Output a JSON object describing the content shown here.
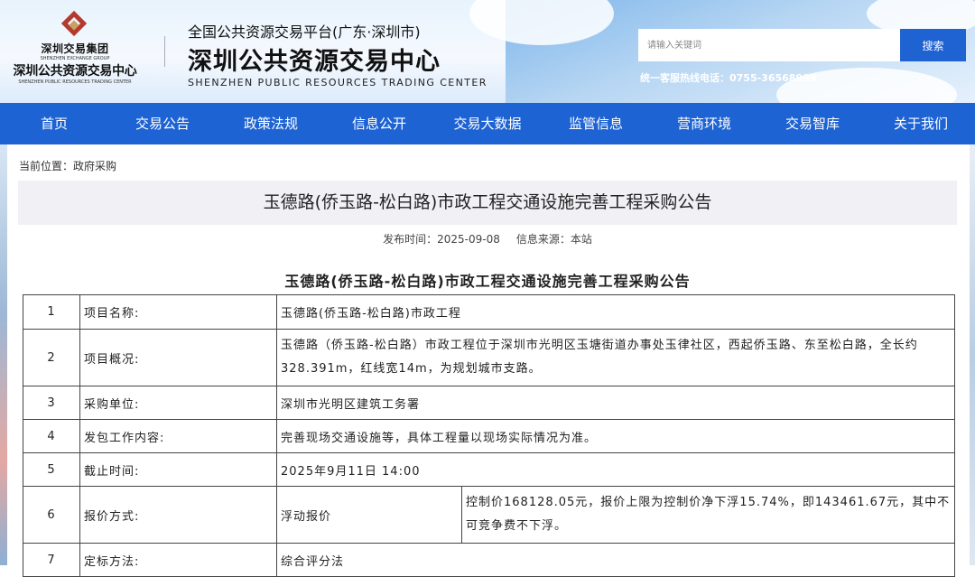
{
  "header": {
    "group_name_cn": "深圳交易集团",
    "group_name_en": "SHENZHEN EXCHANGE GROUP",
    "center_name_cn": "深圳公共资源交易中心",
    "center_name_en": "SHENZHEN PUBLIC RESOURCES TRADING CENTER",
    "platform_title": "全国公共资源交易平台(广东·深圳市)",
    "platform_name": "深圳公共资源交易中心",
    "platform_name_en": "SHENZHEN PUBLIC RESOURCES TRADING CENTER",
    "search_placeholder": "请输入关键词",
    "search_button": "搜索",
    "hotline": "统一客服热线电话：0755-36568999"
  },
  "nav": {
    "items": [
      "首页",
      "交易公告",
      "政策法规",
      "信息公开",
      "交易大数据",
      "监管信息",
      "营商环境",
      "交易智库",
      "关于我们"
    ]
  },
  "breadcrumb": "当前位置：政府采购",
  "article": {
    "title": "玉德路(侨玉路-松白路)市政工程交通设施完善工程采购公告",
    "publish_time": "发布时间：2025-09-08",
    "source": "信息来源：本站",
    "subtitle": "玉德路(侨玉路-松白路)市政工程交通设施完善工程采购公告"
  },
  "table": {
    "rows": [
      {
        "no": "1",
        "label": "项目名称:",
        "value": "玉德路(侨玉路-松白路)市政工程"
      },
      {
        "no": "2",
        "label": "项目概况:",
        "value": "玉德路（侨玉路-松白路）市政工程位于深圳市光明区玉塘街道办事处玉律社区，西起侨玉路、东至松白路，全长约328.391m，红线宽14m，为规划城市支路。"
      },
      {
        "no": "3",
        "label": "采购单位:",
        "value": "深圳市光明区建筑工务署"
      },
      {
        "no": "4",
        "label": "发包工作内容:",
        "value": "完善现场交通设施等，具体工程量以现场实际情况为准。"
      },
      {
        "no": "5",
        "label": "截止时间:",
        "value": "2025年9月11日 14:00"
      },
      {
        "no": "6",
        "label": "报价方式:",
        "value": "浮动报价",
        "extra": "控制价168128.05元，报价上限为控制价净下浮15.74%，即143461.67元，其中不可竞争费不下浮。"
      },
      {
        "no": "7",
        "label": "定标方法:",
        "value": "综合评分法"
      }
    ]
  }
}
